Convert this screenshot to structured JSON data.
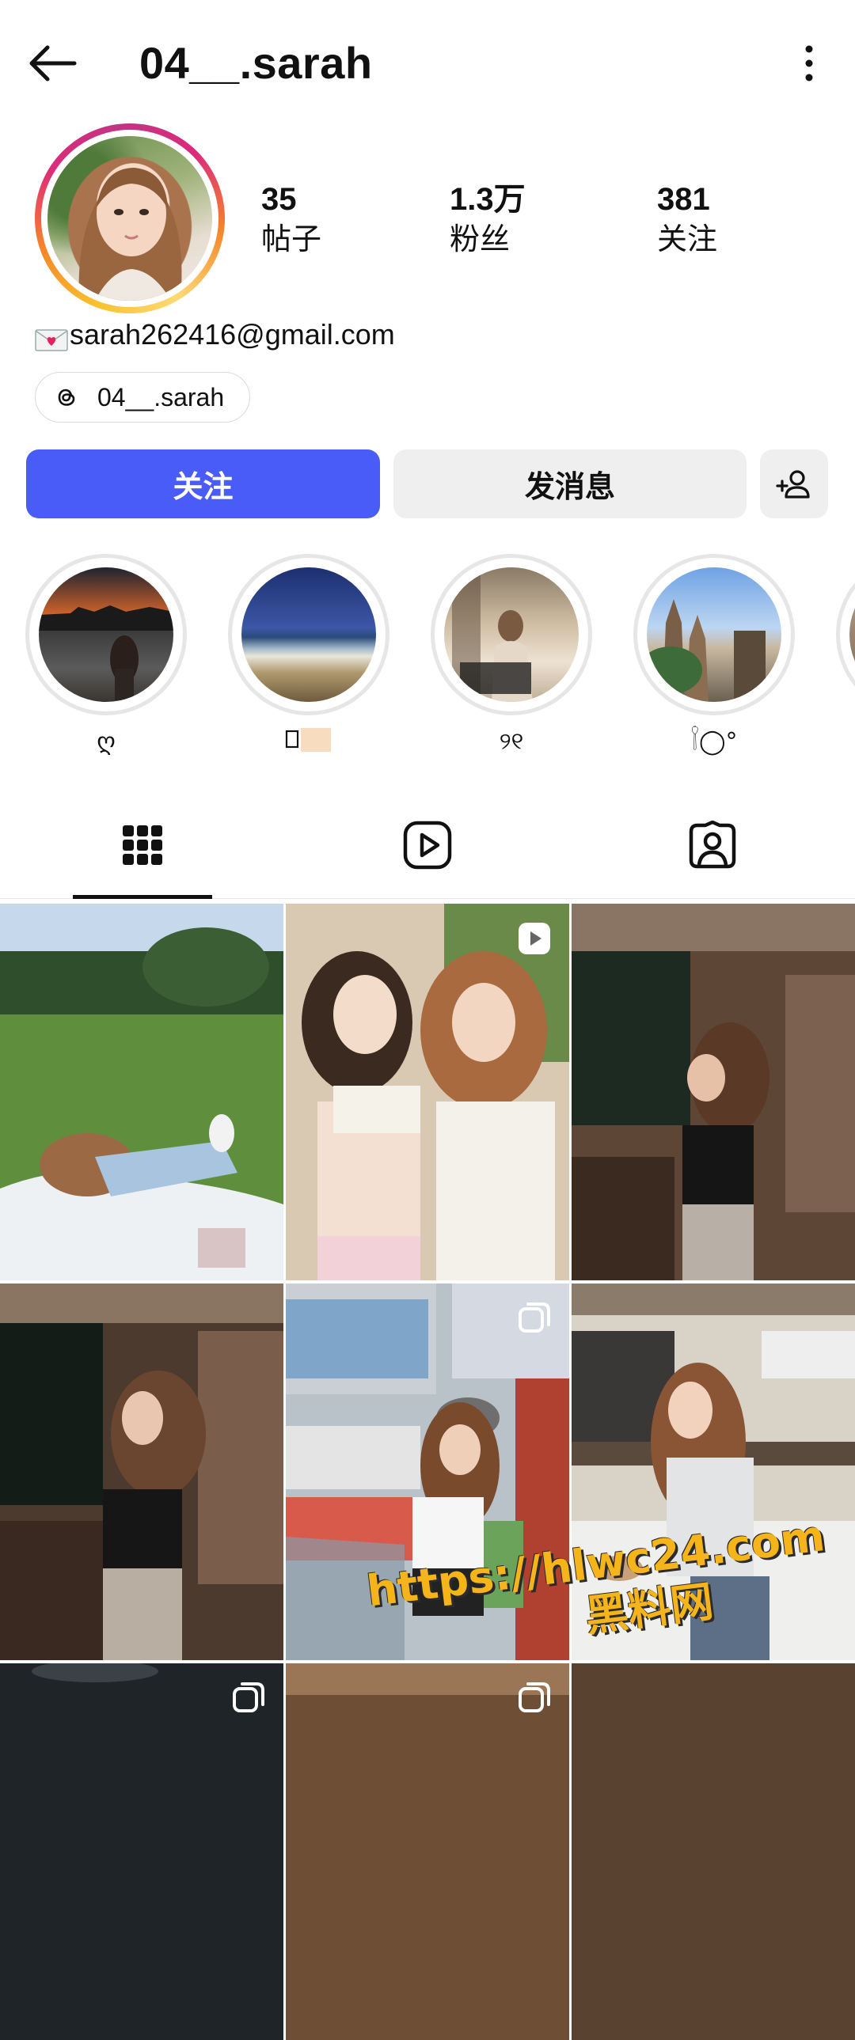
{
  "header": {
    "username": "04__.sarah"
  },
  "stats": [
    {
      "value": "35",
      "label": "帖子"
    },
    {
      "value": "1.3万",
      "label": "粉丝"
    },
    {
      "value": "381",
      "label": "关注"
    }
  ],
  "bio": {
    "email": "sarah262416@gmail.com"
  },
  "threads": {
    "handle": "04__.sarah"
  },
  "actions": {
    "follow_label": "关注",
    "message_label": "发消息"
  },
  "highlights": [
    {
      "label": "ღ"
    },
    {
      "label": "𓍯"
    },
    {
      "label": "୨୧"
    },
    {
      "label": "𓌉◯°"
    }
  ],
  "tabs": [
    {
      "name": "posts"
    },
    {
      "name": "reels"
    },
    {
      "name": "tagged"
    }
  ],
  "watermark": {
    "url": "https://hlwc24.com",
    "label": "黑料网"
  },
  "colors": {
    "follow_button": "#4a5cf7",
    "secondary_button": "#efefef",
    "watermark": "#f6b41b"
  }
}
